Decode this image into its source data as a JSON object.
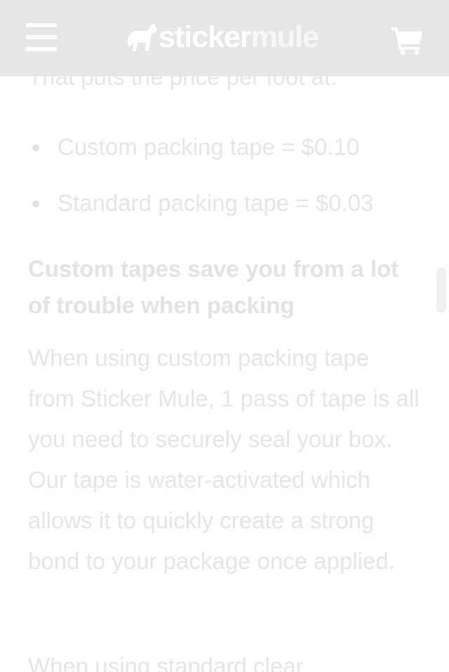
{
  "header": {
    "menu_icon": "hamburger-menu-icon",
    "logo": {
      "icon": "mule-icon",
      "text_sticker": "sticker",
      "text_mule": "mule"
    },
    "cart_icon": "shopping-cart-icon"
  },
  "article": {
    "partial_line": "That puts the price per foot at:",
    "bullets": [
      "Custom packing tape = $0.10",
      "Standard packing tape = $0.03"
    ],
    "heading": "Custom tapes save you from a lot of trouble when packing",
    "paragraph": "When using custom packing tape from Sticker Mule, 1 pass of tape is all you need to securely seal your box. Our tape is water-activated which allows it to quickly create a strong bond to your package once applied.",
    "paragraph2_partial": "When using standard clear"
  },
  "colors": {
    "header_bg": "#e6e6e6",
    "text": "#e6e6e6",
    "icon": "#ffffff"
  }
}
